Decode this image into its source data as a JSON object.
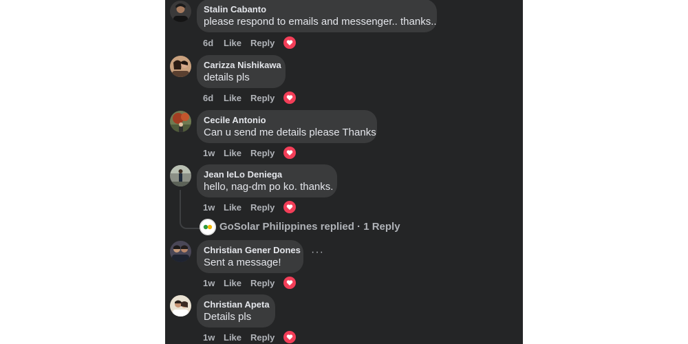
{
  "comments": [
    {
      "author": "Stalin Cabanto",
      "text": "please respond to emails and messenger.. thanks..",
      "time": "6d",
      "like": "Like",
      "reply": "Reply",
      "reaction": "heart-icon",
      "avatar_color": "#3b3a3a"
    },
    {
      "author": "Carizza Nishikawa",
      "text": "details pls",
      "time": "6d",
      "like": "Like",
      "reply": "Reply",
      "reaction": "heart-icon",
      "avatar_color": "#c9a17e"
    },
    {
      "author": "Cecile Antonio",
      "text": "Can u send me details please Thanks",
      "time": "1w",
      "like": "Like",
      "reply": "Reply",
      "reaction": "heart-icon",
      "avatar_color": "#8a5a3c"
    },
    {
      "author": "Jean IeLo Deniega",
      "text": "hello, nag-dm po ko. thanks.",
      "time": "1w",
      "like": "Like",
      "reply": "Reply",
      "reaction": "heart-icon",
      "avatar_color": "#8b8f86"
    },
    {
      "author": "Christian Gener Dones",
      "text": "Sent a message!",
      "time": "1w",
      "like": "Like",
      "reply": "Reply",
      "reaction": "heart-icon",
      "avatar_color": "#4a4757"
    },
    {
      "author": "Christian Apeta",
      "text": "Details pls",
      "time": "1w",
      "like": "Like",
      "reply": "Reply",
      "reaction": "heart-icon",
      "avatar_color": "#e9e1d2"
    }
  ],
  "thread_reply": {
    "page_name": "GoSolar Philippines",
    "summary": "GoSolar Philippines replied · 1 Reply"
  },
  "more_options": "···",
  "colors": {
    "background": "#242526",
    "bubble": "#3a3b3c",
    "text": "#e4e6eb",
    "secondary": "#b0b3b8",
    "reaction": "#f33e58"
  }
}
